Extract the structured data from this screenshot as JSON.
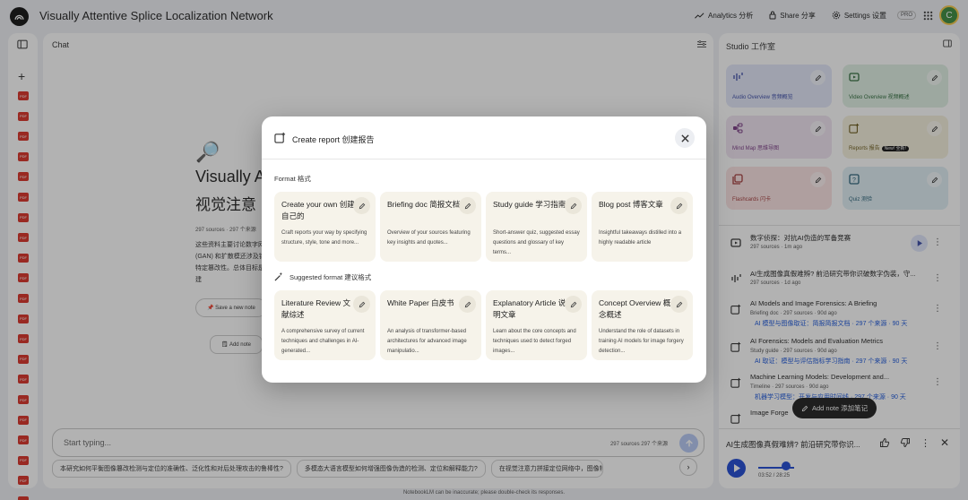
{
  "app": {
    "title": "Visually Attentive Splice Localization Network",
    "analytics_label": "Analytics 分析",
    "share_label": "Share 分享",
    "settings_label": "Settings 设置",
    "pro_badge": "PRO",
    "avatar_letter": "C"
  },
  "chat": {
    "header": "Chat",
    "emoji": "🔎",
    "notebook_title": "Visually A",
    "notebook_title_cn": "视觉注意",
    "meta": "297 sources · 297 个来源",
    "summary": "这些资料主要讨论数字网络 (GAN) 和扩散模还涉及针对特定篡改性。总体目标是创建",
    "save_note": "Save a new note",
    "add_note": "Add note",
    "input_placeholder": "Start typing...",
    "input_count": "297 sources  297 个来源",
    "suggestions": [
      "本研究如何平衡图像篡改检测与定位的准确性、泛化性和对后处理攻击的鲁棒性?",
      "多模态大语言模型如何增强图像伪造的检测、定位和解释能力?",
      "在视觉注意力拼接定位网络中，图像特征"
    ],
    "footer": "NotebookLM can be inaccurate; please double-check its responses."
  },
  "studio": {
    "header": "Studio 工作室",
    "tiles": [
      {
        "label": "Audio Overview 音频概览",
        "icon": "audio-waveform-icon",
        "bg": "#e3e7f9",
        "color": "#3a4ba8"
      },
      {
        "label": "Video Overview 视频概述",
        "icon": "video-icon",
        "bg": "#dff0e4",
        "color": "#2e6b3b"
      },
      {
        "label": "Mind Map 思维导图",
        "icon": "mind-map-icon",
        "bg": "#f0e4f1",
        "color": "#7a3a85"
      },
      {
        "label": "Reports 报告",
        "icon": "reports-icon",
        "bg": "#f5f0dc",
        "color": "#6b5a1a",
        "badge": "New! 全新!"
      },
      {
        "label": "Flashcards 闪卡",
        "icon": "flashcards-icon",
        "bg": "#fbe3e3",
        "color": "#a33a3a"
      },
      {
        "label": "Quiz 测验",
        "icon": "quiz-icon",
        "bg": "#dfeff5",
        "color": "#2a6278"
      }
    ],
    "artifacts": [
      {
        "title": "数字侦探：对抗AI伪造的军备竞赛",
        "meta": "297 sources · 1m ago",
        "extra": "",
        "icon": "video-icon"
      },
      {
        "title": "AI生成图像真假难辨? 前沿研究带你识破数字伪装，守...",
        "meta": "297 sources · 1d ago",
        "extra": "",
        "icon": "audio-waveform-icon"
      },
      {
        "title": "AI Models and Image Forensics: A Briefing",
        "meta": "Briefing doc · 297 sources · 90d ago",
        "extra": "AI 模型与图像取证：简报简报文档 · 297 个来源 · 90 天",
        "icon": "reports-icon"
      },
      {
        "title": "AI Forensics: Models and Evaluation Metrics",
        "meta": "Study guide · 297 sources · 90d ago",
        "extra": "AI 取证：模型与评估指标学习指南 · 297 个来源 · 90 天",
        "icon": "reports-icon"
      },
      {
        "title": "Machine Learning Models: Development and...",
        "meta": "Timeline · 297 sources · 90d ago",
        "extra": "机器学习模型：开发与应用时间线 · 297 个来源 · 90 天",
        "icon": "reports-icon"
      },
      {
        "title": "Image Forge",
        "meta": "",
        "extra": "",
        "icon": "reports-icon"
      }
    ],
    "add_note_pill": "Add note 添加笔记",
    "player": {
      "title": "AI生成图像真假难辨? 前沿研究带你识...",
      "time": "03:52 / 28:25"
    }
  },
  "modal": {
    "title": "Create report 创建报告",
    "format_label": "Format 格式",
    "suggested_label": "Suggested format 建议格式",
    "formats": [
      {
        "title": "Create your own 创建自己的",
        "desc": "Craft reports your way by specifying structure, style, tone and more..."
      },
      {
        "title": "Briefing doc 简报文档",
        "desc": "Overview of your sources featuring key insights and quotes..."
      },
      {
        "title": "Study guide 学习指南",
        "desc": "Short-answer quiz, suggested essay questions and glossary of key terms..."
      },
      {
        "title": "Blog post 博客文章",
        "desc": "Insightful takeaways distilled into a highly readable article"
      }
    ],
    "suggested": [
      {
        "title": "Literature Review 文献综述",
        "desc": "A comprehensive survey of current techniques and challenges in AI-generated..."
      },
      {
        "title": "White Paper 白皮书",
        "desc": "An analysis of transformer-based architectures for advanced image manipulatio..."
      },
      {
        "title": "Explanatory Article 说明文章",
        "desc": "Learn about the core concepts and techniques used to detect forged images..."
      },
      {
        "title": "Concept Overview 概念概述",
        "desc": "Understand the role of datasets in training AI models for image forgery detection..."
      }
    ]
  }
}
